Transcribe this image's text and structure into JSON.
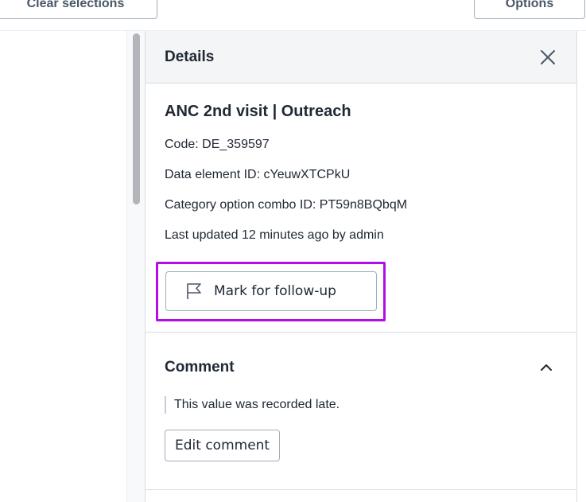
{
  "top_bar": {
    "clear_label": "Clear selections",
    "options_label": "Options"
  },
  "details_panel": {
    "header_title": "Details",
    "close_icon": "close-icon",
    "item_title": "ANC 2nd visit | Outreach",
    "code_line": "Code: DE_359597",
    "data_element_line": "Data element ID: cYeuwXTCPkU",
    "coc_line": "Category option combo ID: PT59n8BQbqM",
    "last_updated_line": "Last updated 12 minutes ago by admin",
    "followup_label": "Mark for follow-up",
    "followup_icon": "flag-icon",
    "highlight_color": "#b00fe8"
  },
  "comment_section": {
    "title": "Comment",
    "chevron_icon": "chevron-up-icon",
    "text": "This value was recorded late.",
    "edit_label": "Edit comment"
  }
}
